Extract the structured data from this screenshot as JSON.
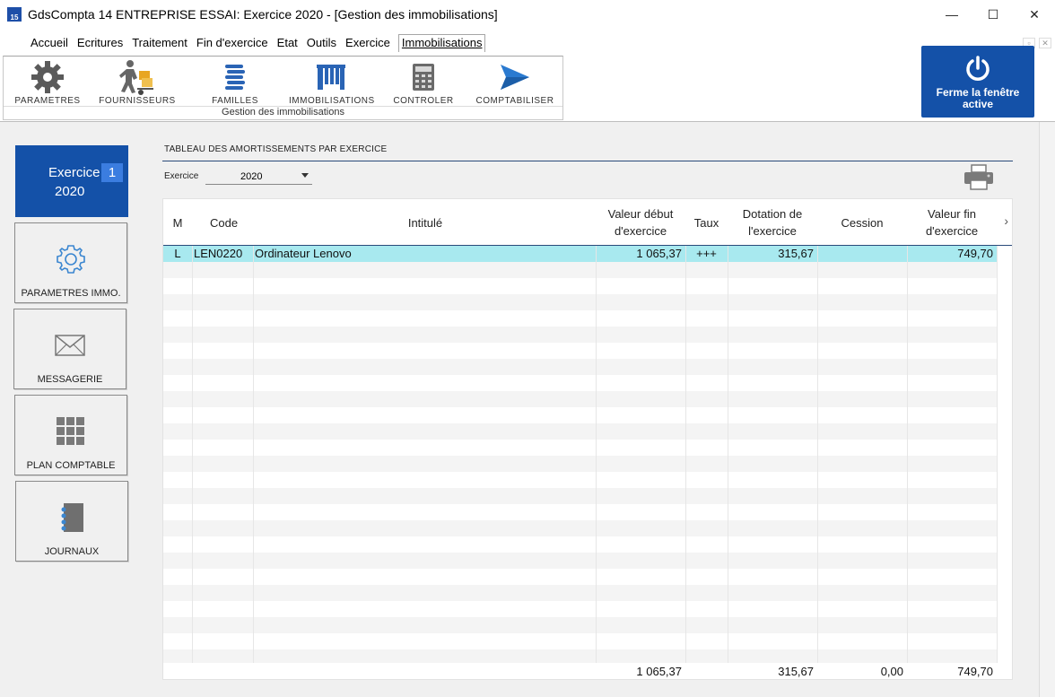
{
  "window": {
    "title": "GdsCompta 14 ENTREPRISE ESSAI: Exercice 2020 - [Gestion des immobilisations]",
    "app_icon_text": "15",
    "minimize": "—",
    "maximize": "☐",
    "close": "✕"
  },
  "menu": {
    "items": [
      "Accueil",
      "Ecritures",
      "Traitement",
      "Fin d'exercice",
      "Etat",
      "Outils",
      "Exercice",
      "Immobilisations"
    ],
    "active_index": 7
  },
  "ribbon": {
    "items": [
      {
        "label": "PARAMETRES",
        "icon": "gear-icon"
      },
      {
        "label": "FOURNISSEURS",
        "icon": "delivery-person-icon"
      },
      {
        "label": "FAMILLES",
        "icon": "stack-icon"
      },
      {
        "label": "IMMOBILISATIONS",
        "icon": "building-icon"
      },
      {
        "label": "CONTROLER",
        "icon": "calculator-icon"
      },
      {
        "label": "COMPTABILISER",
        "icon": "send-icon"
      }
    ],
    "group_label": "Gestion des immobilisations"
  },
  "close_window": {
    "line1": "Ferme la fenêtre",
    "line2": "active"
  },
  "sidebar": {
    "exercice_label": "Exercice",
    "exercice_badge": "1",
    "exercice_year": "2020",
    "buttons": [
      {
        "label": "PARAMETRES IMMO.",
        "icon": "gear-outline-icon"
      },
      {
        "label": "MESSAGERIE",
        "icon": "envelope-icon"
      },
      {
        "label": "PLAN COMPTABLE",
        "icon": "grid-icon"
      },
      {
        "label": "JOURNAUX",
        "icon": "notebook-icon"
      }
    ]
  },
  "panel": {
    "title": "TABLEAU DES AMORTISSEMENTS PAR EXERCICE",
    "exercice_label": "Exercice",
    "exercice_value": "2020"
  },
  "table": {
    "headers": {
      "m": "M",
      "code": "Code",
      "intitule": "Intitulé",
      "valeur_debut_1": "Valeur début",
      "valeur_debut_2": "d'exercice",
      "taux": "Taux",
      "dotation_1": "Dotation de",
      "dotation_2": "l'exercice",
      "cession": "Cession",
      "valeur_fin_1": "Valeur fin",
      "valeur_fin_2": "d'exercice"
    },
    "rows": [
      {
        "m": "L",
        "code": "LEN0220",
        "intitule": "Ordinateur Lenovo",
        "valeur_debut": "1 065,37",
        "taux": "+++",
        "dotation": "315,67",
        "cession": "",
        "valeur_fin": "749,70"
      }
    ],
    "totals": {
      "valeur_debut": "1 065,37",
      "dotation": "315,67",
      "cession": "0,00",
      "valeur_fin": "749,70"
    }
  }
}
